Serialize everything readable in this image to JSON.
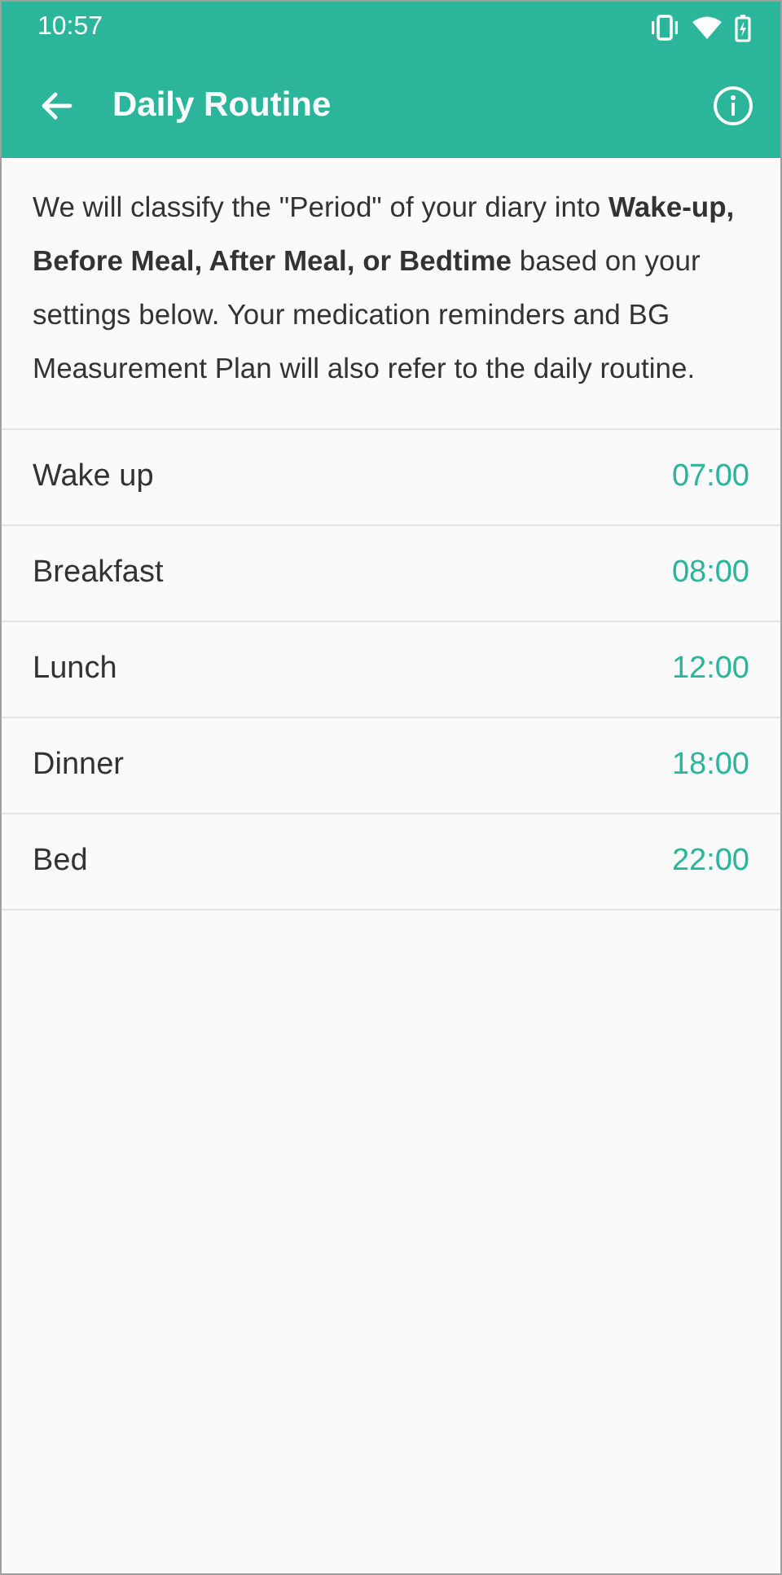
{
  "status_bar": {
    "time": "10:57"
  },
  "app_bar": {
    "title": "Daily Routine"
  },
  "description": "We will classify the \"Period\" of your diary into **Wake-up, Before Meal, After Meal, or Bedtime** based on your settings below. Your medication reminders and BG Measurement Plan will also refer to the daily routine.",
  "routine": [
    {
      "label": "Wake up",
      "time": "07:00"
    },
    {
      "label": "Breakfast",
      "time": "08:00"
    },
    {
      "label": "Lunch",
      "time": "12:00"
    },
    {
      "label": "Dinner",
      "time": "18:00"
    },
    {
      "label": "Bed",
      "time": "22:00"
    }
  ]
}
